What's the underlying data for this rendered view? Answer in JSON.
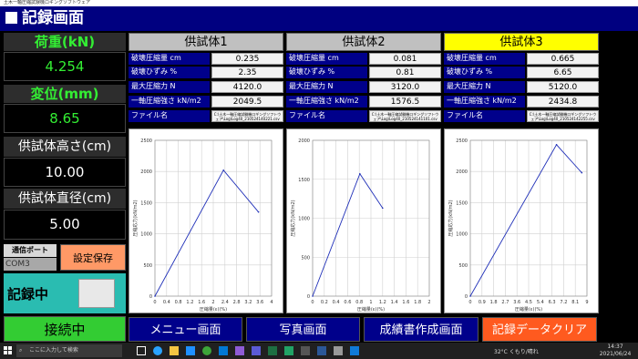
{
  "window_title": "土木一軸圧縮試験機ロギングソフトウェア",
  "header": {
    "title": "記録画面"
  },
  "left": {
    "load_label": "荷重(kN)",
    "load_value": "4.254",
    "disp_label": "変位(mm)",
    "disp_value": "8.65",
    "height_label": "供試体高さ(cm)",
    "height_value": "10.00",
    "diameter_label": "供試体直径(cm)",
    "diameter_value": "5.00",
    "port_label": "通信ポート",
    "port_value": "COM3",
    "save_button": "設定保存",
    "recording_label": "記録中",
    "connected_button": "接続中"
  },
  "row_labels": [
    "破壊圧縮量 cm",
    "破壊ひずみ %",
    "最大圧縮力 N",
    "一軸圧縮強さ kN/m2",
    "ファイル名"
  ],
  "specimens": [
    {
      "title": "供試体1",
      "values": [
        "0.235",
        "2.35",
        "4120.0",
        "2049.5"
      ],
      "filename": "C:\\土木一軸圧縮試験機ロギングソフトウェア\\Log\\Log40_210524140221.csv",
      "active": false
    },
    {
      "title": "供試体2",
      "values": [
        "0.081",
        "0.81",
        "3120.0",
        "1576.5"
      ],
      "filename": "C:\\土木一軸圧縮試験機ロギングソフトウェア\\Log\\Log40_210524141101.csv",
      "active": false
    },
    {
      "title": "供試体3",
      "values": [
        "0.665",
        "6.65",
        "5120.0",
        "2434.8"
      ],
      "filename": "C:\\土木一軸圧縮試験機ロギングソフトウェア\\Log\\Log40_210524142255.csv",
      "active": true
    }
  ],
  "chart_data": [
    {
      "type": "line",
      "xlabel": "圧縮量(ε)(%)",
      "ylabel": "圧縮応力(kN/m2)",
      "ylim": [
        0,
        2500
      ],
      "xlim": [
        0,
        4
      ],
      "xticks": [
        "0",
        "0.4",
        "0.8",
        "1.2",
        "1.6",
        "2",
        "2.4",
        "2.8",
        "3.2",
        "3.6",
        "4"
      ],
      "yticks": [
        "0",
        "500",
        "1000",
        "1500",
        "2000",
        "2500"
      ],
      "grid": true,
      "series": [
        {
          "x": [
            0,
            2.35,
            3.55
          ],
          "y": [
            0,
            2020,
            1350
          ]
        }
      ]
    },
    {
      "type": "line",
      "xlabel": "圧縮量(ε)(%)",
      "ylabel": "圧縮応力(kN/m2)",
      "ylim": [
        0,
        2000
      ],
      "xlim": [
        0,
        2
      ],
      "xticks": [
        "0",
        "0.2",
        "0.4",
        "0.6",
        "0.8",
        "1",
        "1.2",
        "1.4",
        "1.6",
        "1.8",
        "2"
      ],
      "yticks": [
        "0",
        "500",
        "1000",
        "1500",
        "2000"
      ],
      "grid": true,
      "series": [
        {
          "x": [
            0,
            0.81,
            1.2
          ],
          "y": [
            0,
            1570,
            1130
          ]
        }
      ]
    },
    {
      "type": "line",
      "xlabel": "圧縮量(ε)(%)",
      "ylabel": "圧縮応力(kN/m2)",
      "ylim": [
        0,
        2500
      ],
      "xlim": [
        0,
        9
      ],
      "xticks": [
        "0",
        "0.9",
        "1.8",
        "2.7",
        "3.6",
        "4.5",
        "5.4",
        "6.3",
        "7.2",
        "8.1",
        "9"
      ],
      "yticks": [
        "0",
        "500",
        "1000",
        "1500",
        "2000",
        "2500"
      ],
      "grid": true,
      "series": [
        {
          "x": [
            0,
            6.65,
            8.6
          ],
          "y": [
            0,
            2430,
            1980
          ]
        }
      ]
    }
  ],
  "bottom_buttons": {
    "menu": "メニュー画面",
    "photo": "写真画面",
    "report": "成績書作成画面",
    "clear": "記録データクリア"
  },
  "taskbar": {
    "search_placeholder": "ここに入力して検索",
    "weather": "32°C くもり/晴れ",
    "time": "14:37",
    "date": "2021/06/24"
  },
  "colors": {
    "header": "#000080",
    "green_value": "#33ee33",
    "active_specimen": "#ffff00",
    "inactive_specimen": "#c0c0c0",
    "teal": "#2abcb1",
    "connected": "#33cc33",
    "clear_button": "#ff5a1f",
    "save_button": "#ff9966"
  }
}
